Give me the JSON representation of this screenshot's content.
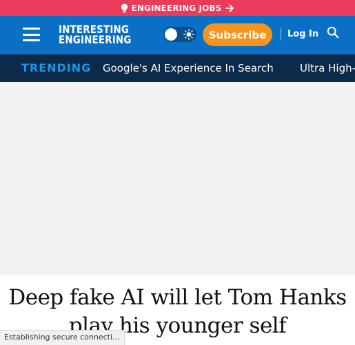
{
  "banner": {
    "label": "ENGINEERING JOBS",
    "icon": "lightbulb-icon",
    "arrow_icon": "arrow-right-icon",
    "color": "#ea3b5a"
  },
  "nav": {
    "menu_icon": "hamburger-icon",
    "logo_line1": "INTERESTING",
    "logo_line2": "ENGINEERING",
    "theme_toggle_icon": "sun-icon",
    "subscribe_label": "Subscribe",
    "login_label": "Log In",
    "search_icon": "search-icon",
    "color": "#0a70c5",
    "accent": "#f7941d"
  },
  "trending": {
    "label": "TRENDING",
    "items": [
      "Google's AI Experience In Search",
      "Ultra High-"
    ],
    "color": "#0c2a4a"
  },
  "article": {
    "headline": "Deep fake AI will let Tom Hanks play his younger self"
  },
  "status_bar": {
    "text": "Establishing secure connecti..."
  }
}
